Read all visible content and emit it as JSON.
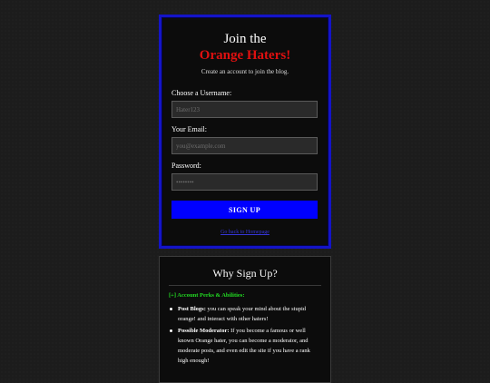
{
  "signup": {
    "title_line1": "Join the",
    "title_line2": "Orange Haters!",
    "subtitle": "Create an account to join the blog.",
    "username": {
      "label": "Choose a Username:",
      "placeholder": "Hater123",
      "value": ""
    },
    "email": {
      "label": "Your Email:",
      "placeholder": "you@example.com",
      "value": ""
    },
    "password": {
      "label": "Password:",
      "placeholder": "••••••••",
      "value": ""
    },
    "submit_label": "SIGN UP",
    "back_link": "Go back to Homepage"
  },
  "why": {
    "title": "Why Sign Up?",
    "perks_heading": "[+] Account Perks & Abilities:",
    "perks": [
      {
        "name": "Post Blogs:",
        "text": " you can speak your mind about the stupid orange! and interact with other haters!"
      },
      {
        "name": "Possible Moderator:",
        "text": " If you become a famous or well known Orange hater, you can become a moderator, and moderate posts, and even edit the site if you have a rank high enough!"
      }
    ]
  },
  "colors": {
    "accent_blue": "#0000ff",
    "brand_red": "#e01010",
    "perk_green": "#22dd22"
  }
}
